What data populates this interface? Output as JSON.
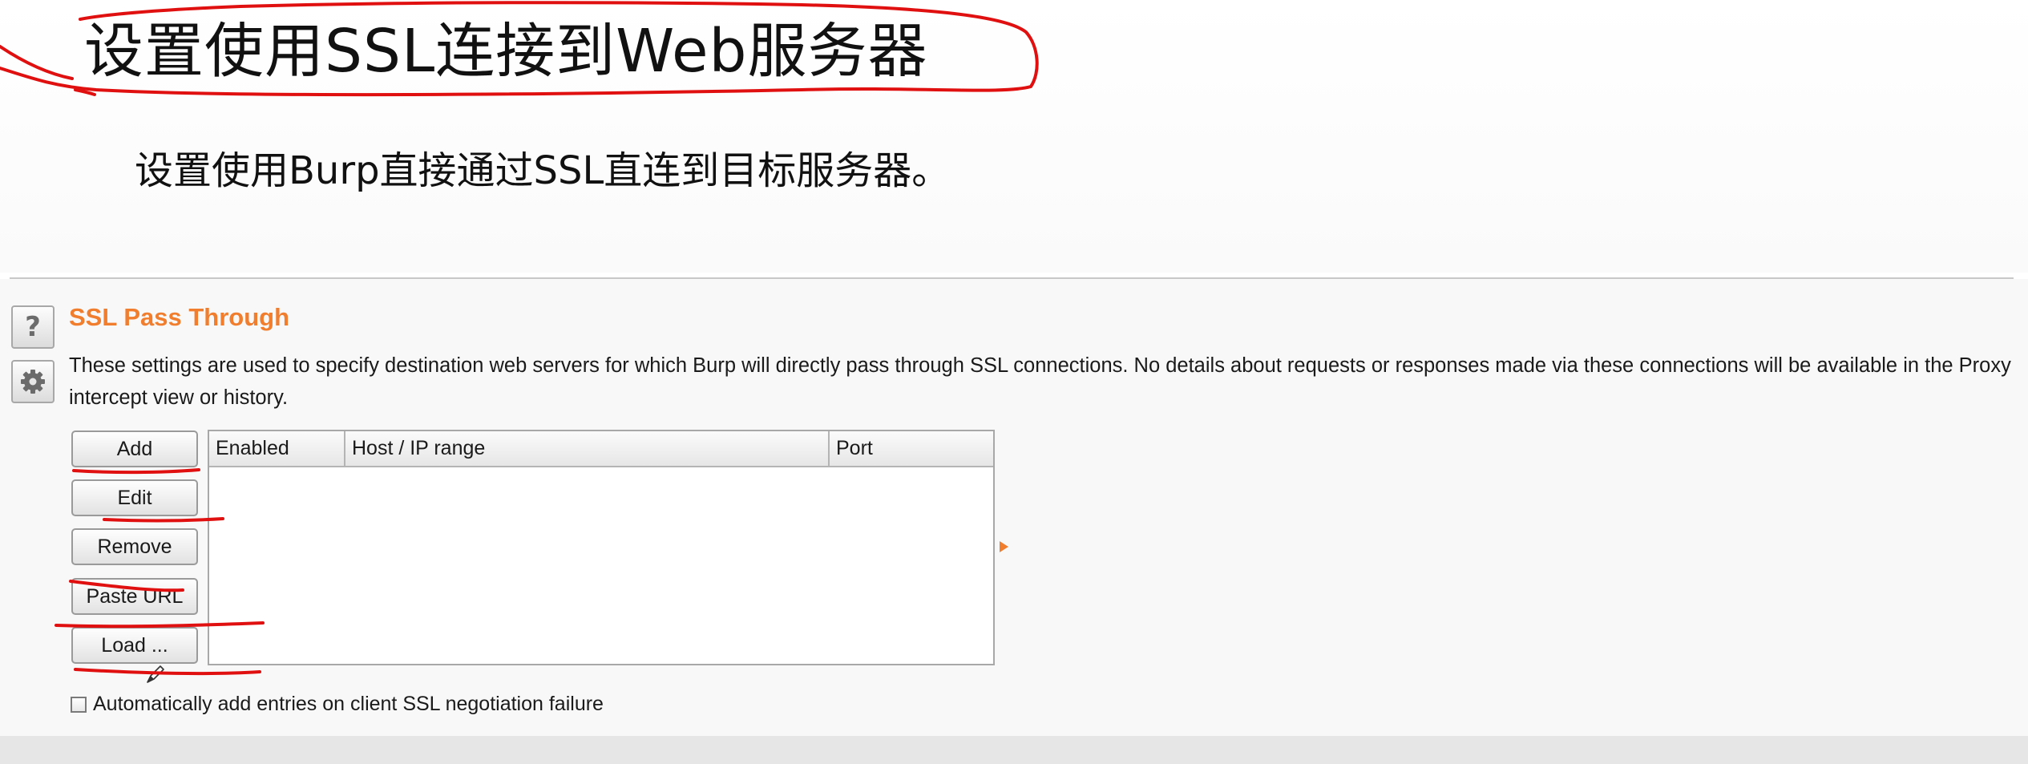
{
  "slide": {
    "title": "设置使用SSL连接到Web服务器",
    "subtitle": "设置使用Burp直接通过SSL直连到目标服务器。"
  },
  "panel": {
    "help_icon": "question-mark-icon",
    "settings_icon": "gear-icon",
    "section_title": "SSL Pass Through",
    "description": "These settings are used to specify destination web servers for which Burp will directly pass through SSL connections. No details about requests or responses made via these connections will be available in the Proxy intercept view or history.",
    "buttons": {
      "add": "Add",
      "edit": "Edit",
      "remove": "Remove",
      "paste_url": "Paste URL",
      "load": "Load ..."
    },
    "table": {
      "columns": [
        "Enabled",
        "Host / IP range",
        "Port"
      ],
      "rows": []
    },
    "checkbox": {
      "label": "Automatically add entries on client SSL negotiation failure",
      "checked": false
    }
  },
  "colors": {
    "accent_orange": "#f07e2e",
    "annotation_red": "#e01010"
  }
}
